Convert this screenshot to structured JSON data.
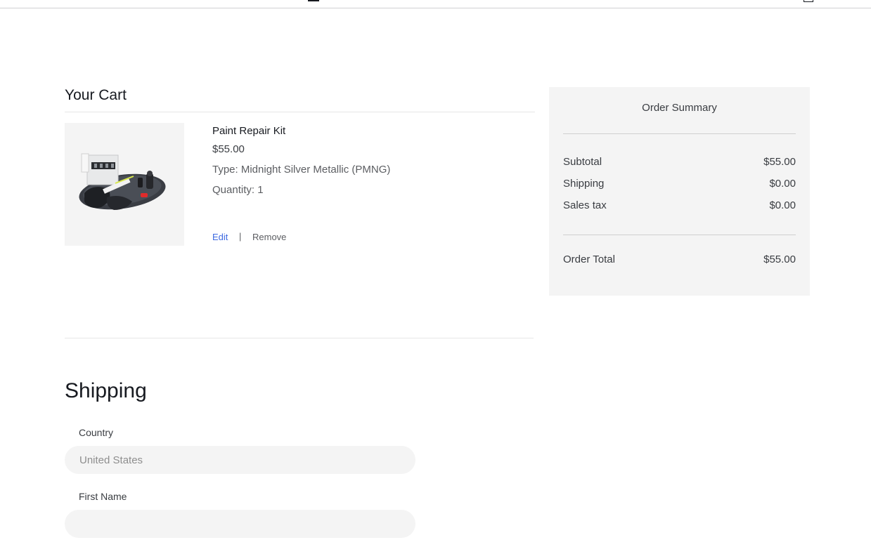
{
  "cart": {
    "title": "Your Cart",
    "item": {
      "name": "Paint Repair Kit",
      "price": "$55.00",
      "type": "Type: Midnight Silver Metallic (PMNG)",
      "quantity": "Quantity: 1",
      "edit_label": "Edit",
      "separator": "|",
      "remove_label": "Remove"
    }
  },
  "summary": {
    "title": "Order Summary",
    "rows": [
      {
        "label": "Subtotal",
        "value": "$55.00"
      },
      {
        "label": "Shipping",
        "value": "$0.00"
      },
      {
        "label": "Sales tax",
        "value": "$0.00"
      }
    ],
    "total": {
      "label": "Order Total",
      "value": "$55.00"
    }
  },
  "shipping": {
    "title": "Shipping",
    "country": {
      "label": "Country",
      "value": "United States"
    },
    "first_name": {
      "label": "First Name",
      "value": ""
    }
  },
  "colors": {
    "accent_link": "#3e6ae1",
    "text_primary": "#171a20",
    "panel_bg": "#f4f4f4"
  }
}
